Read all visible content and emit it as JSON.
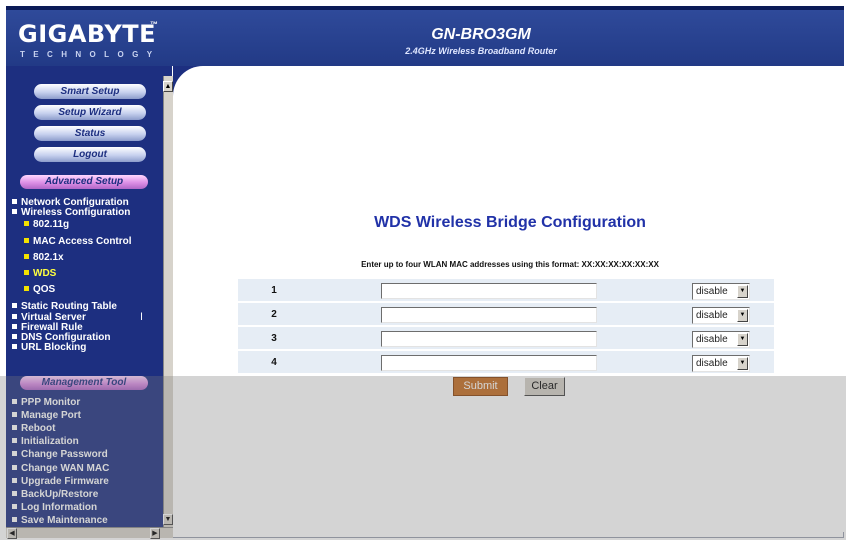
{
  "header": {
    "logo": "GIGABYTE",
    "logo_tm": "™",
    "logo_sub": "TECHNOLOGY",
    "model": "GN-BRO3GM",
    "model_sub": "2.4GHz Wireless Broadband Router"
  },
  "sidebar": {
    "buttons": [
      "Smart Setup",
      "Setup Wizard",
      "Status",
      "Logout"
    ],
    "advanced_label": "Advanced Setup",
    "advanced_items": [
      {
        "label": "Network Configuration",
        "sub": false
      },
      {
        "label": "Wireless Configuration",
        "sub": false
      },
      {
        "label": "802.11g",
        "sub": true
      },
      {
        "label": "MAC Access Control",
        "sub": true
      },
      {
        "label": "802.1x",
        "sub": true
      },
      {
        "label": "WDS",
        "sub": true,
        "active": true
      },
      {
        "label": "QOS",
        "sub": true
      },
      {
        "label": "Static Routing Table",
        "sub": false
      },
      {
        "label": "Virtual Server",
        "sub": false
      },
      {
        "label": "Firewall Rule",
        "sub": false
      },
      {
        "label": "DNS Configuration",
        "sub": false
      },
      {
        "label": "URL Blocking",
        "sub": false
      }
    ],
    "management_label": "Management Tool",
    "management_items": [
      "PPP Monitor",
      "Manage Port",
      "Reboot",
      "Initialization",
      "Change Password",
      "Change WAN MAC",
      "Upgrade Firmware",
      "BackUp/Restore",
      "Log Information",
      "Save Maintenance"
    ]
  },
  "main": {
    "title": "WDS Wireless Bridge Configuration",
    "hint": "Enter up to four WLAN MAC addresses using this format: XX:XX:XX:XX:XX:XX",
    "rows": [
      {
        "num": "1",
        "mac": "",
        "select": "disable"
      },
      {
        "num": "2",
        "mac": "",
        "select": "disable"
      },
      {
        "num": "3",
        "mac": "",
        "select": "disable"
      },
      {
        "num": "4",
        "mac": "",
        "select": "disable"
      }
    ],
    "submit_label": "Submit",
    "clear_label": "Clear"
  },
  "colors": {
    "header_blue": "#223a86",
    "sidebar_blue": "#1d2f80",
    "title_blue": "#2132a8",
    "submit_orange": "#c56b1e",
    "row_bg": "#e6edf5"
  }
}
